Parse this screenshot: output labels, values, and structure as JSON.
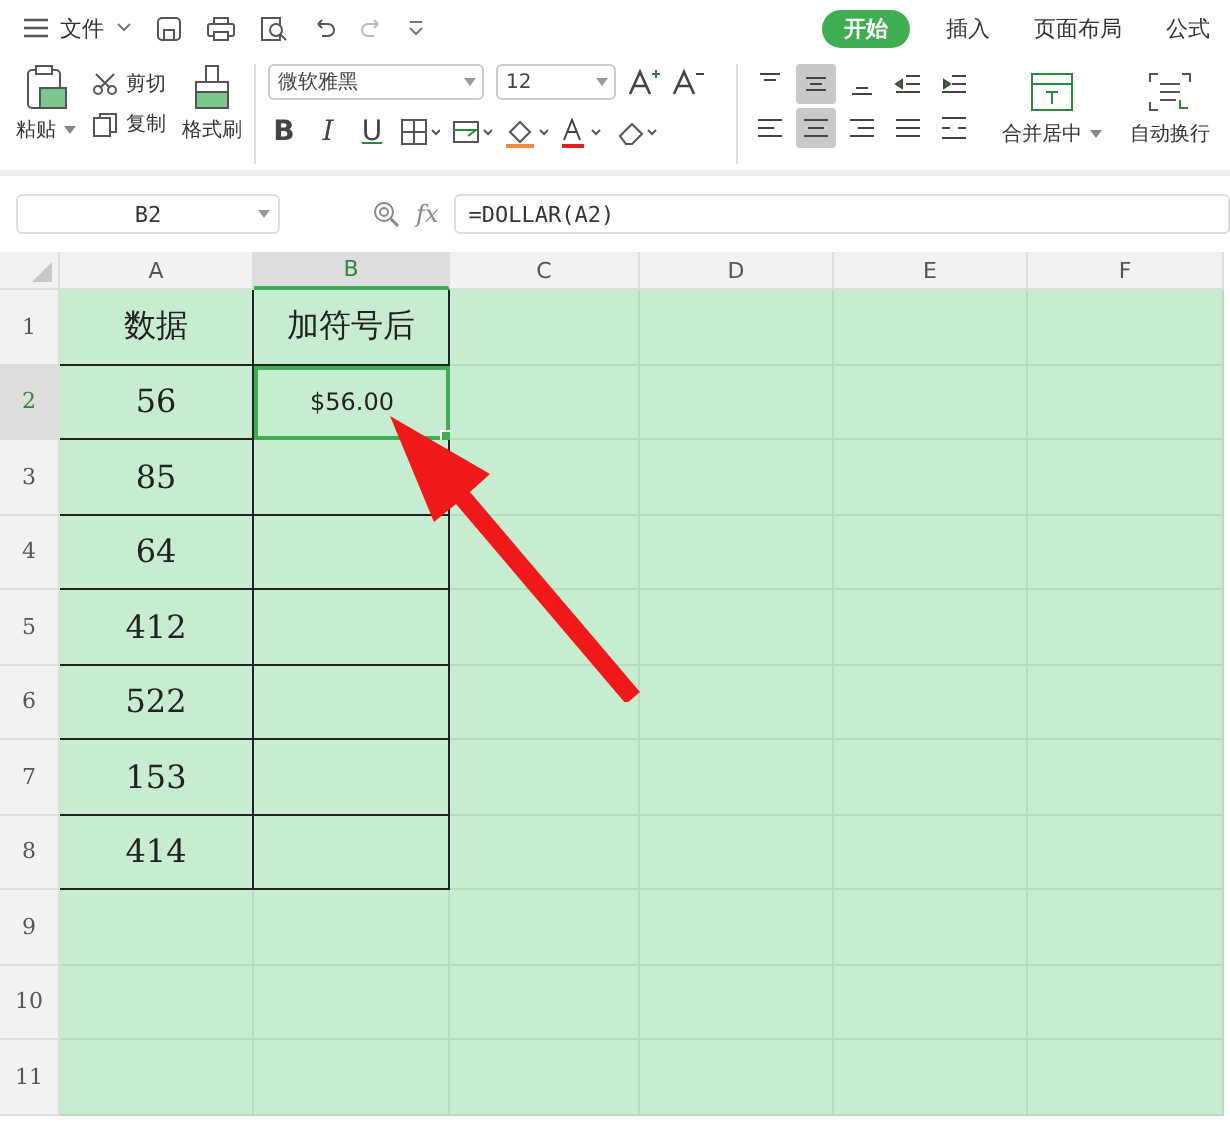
{
  "menu": {
    "file": "文件",
    "tabs": [
      {
        "label": "开始",
        "selected": true
      },
      {
        "label": "插入",
        "selected": false
      },
      {
        "label": "页面布局",
        "selected": false
      },
      {
        "label": "公式",
        "selected": false
      }
    ]
  },
  "ribbon": {
    "paste": "粘贴",
    "cut": "剪切",
    "copy": "复制",
    "format_painter": "格式刷",
    "font_name": "微软雅黑",
    "font_size": "12",
    "bold": "B",
    "italic": "I",
    "underline": "U",
    "align_top": [
      {
        "selected": false
      },
      {
        "selected": true
      },
      {
        "selected": false
      },
      {
        "selected": false
      },
      {
        "selected": false
      }
    ],
    "align_bottom": [
      {
        "selected": false
      },
      {
        "selected": true
      },
      {
        "selected": false
      },
      {
        "selected": false
      },
      {
        "selected": false
      }
    ],
    "merge": "合并居中",
    "wrap": "自动换行"
  },
  "formula_bar": {
    "name_box": "B2",
    "fx": "fx",
    "formula": "=DOLLAR(A2)"
  },
  "columns": [
    {
      "label": "A",
      "selected": false
    },
    {
      "label": "B",
      "selected": true
    },
    {
      "label": "C",
      "selected": false
    },
    {
      "label": "D",
      "selected": false
    },
    {
      "label": "E",
      "selected": false
    },
    {
      "label": "F",
      "selected": false
    }
  ],
  "rows": [
    {
      "number": "1",
      "selected": false,
      "bordered": true,
      "cells": [
        {
          "text": "数据",
          "kind": "text"
        },
        {
          "text": "加符号后",
          "kind": "text"
        }
      ]
    },
    {
      "number": "2",
      "selected": true,
      "bordered": true,
      "cells": [
        {
          "text": "56",
          "kind": "text"
        },
        {
          "text": "$56.00",
          "kind": "formula"
        }
      ]
    },
    {
      "number": "3",
      "selected": false,
      "bordered": true,
      "cells": [
        {
          "text": "85",
          "kind": "text"
        }
      ]
    },
    {
      "number": "4",
      "selected": false,
      "bordered": true,
      "cells": [
        {
          "text": "64",
          "kind": "text"
        }
      ]
    },
    {
      "number": "5",
      "selected": false,
      "bordered": true,
      "cells": [
        {
          "text": "412",
          "kind": "text"
        }
      ]
    },
    {
      "number": "6",
      "selected": false,
      "bordered": true,
      "cells": [
        {
          "text": "522",
          "kind": "text"
        }
      ]
    },
    {
      "number": "7",
      "selected": false,
      "bordered": true,
      "cells": [
        {
          "text": "153",
          "kind": "text"
        }
      ]
    },
    {
      "number": "8",
      "selected": false,
      "bordered": true,
      "cells": [
        {
          "text": "414",
          "kind": "text"
        }
      ]
    },
    {
      "number": "9",
      "selected": false,
      "bordered": false,
      "cells": []
    },
    {
      "number": "10",
      "selected": false,
      "bordered": false,
      "cells": []
    },
    {
      "number": "11",
      "selected": false,
      "bordered": false,
      "cells": []
    }
  ]
}
